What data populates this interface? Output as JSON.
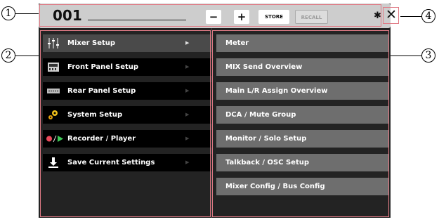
{
  "callouts": [
    "1",
    "2",
    "3",
    "4"
  ],
  "top_bar": {
    "scene_number": "001",
    "minus_label": "−",
    "plus_label": "+",
    "store_label": "STORE",
    "recall_label": "RECALL",
    "settings_icon": "gear-icon",
    "close_icon": "close-icon",
    "close_label": "✕"
  },
  "menu": {
    "items": [
      {
        "label": "Mixer Setup",
        "icon": "mixer-sliders-icon",
        "arrow": "▶"
      },
      {
        "label": "Front Panel Setup",
        "icon": "front-panel-icon",
        "arrow": "▶"
      },
      {
        "label": "Rear Panel Setup",
        "icon": "rear-panel-icon",
        "arrow": "▶"
      },
      {
        "label": "System Setup",
        "icon": "gears-icon",
        "arrow": "▶"
      },
      {
        "label": "Recorder / Player",
        "icon": "record-play-icon",
        "arrow": "▶"
      },
      {
        "label": "Save Current Settings",
        "icon": "save-download-icon",
        "arrow": "▶"
      }
    ],
    "selected": "Mixer Setup"
  },
  "submenu": {
    "items": [
      {
        "label": "Meter"
      },
      {
        "label": "MIX Send Overview"
      },
      {
        "label": "Main L/R Assign Overview"
      },
      {
        "label": "DCA / Mute Group"
      },
      {
        "label": "Monitor / Solo Setup"
      },
      {
        "label": "Talkback / OSC Setup"
      },
      {
        "label": "Mixer Config / Bus Config"
      }
    ]
  },
  "colors": {
    "highlight_box": "#e07a85",
    "screen_bg": "#232323",
    "top_bar_bg": "#cdcdcd",
    "menu_active_bg": "#4a4a4a",
    "submenu_bg": "#6e6e6e",
    "record_red": "#e8495a",
    "play_green": "#3ec957"
  }
}
